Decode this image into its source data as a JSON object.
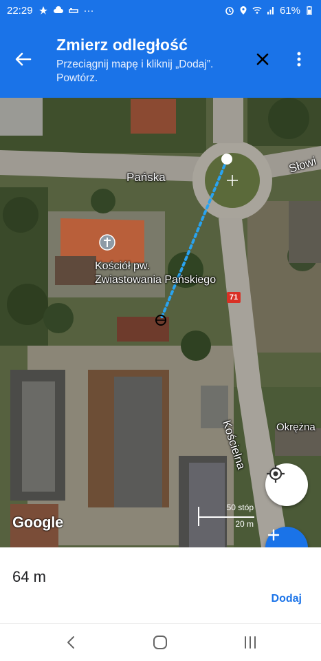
{
  "status_bar": {
    "time": "22:29",
    "more_indicator": "···",
    "battery": "61%"
  },
  "app_bar": {
    "title": "Zmierz odległość",
    "subtitle": "Przeciągnij mapę i kliknij „Dodaj”. Powtórz.",
    "icons": [
      "arrow-back-icon",
      "close-icon",
      "more-vert-icon"
    ]
  },
  "map": {
    "labels": {
      "street_panska": "Pańska",
      "street_slow": "Słowi",
      "church_line1": "Kościół pw.",
      "church_line2": "Zwiastowania Pańskiego",
      "street_koscielna": "Kościelna",
      "street_okrezna": "Okrężna",
      "road_badge": "71"
    },
    "logo": "Google",
    "scale": {
      "imperial": "50 stóp",
      "metric": "20 m"
    },
    "colors": {
      "measure_line": "#29a3f0",
      "accent": "#1a73e8",
      "road_badge": "#d93025"
    }
  },
  "bottom_sheet": {
    "distance": "64 m",
    "add_label": "Dodaj"
  },
  "nav_bar": {
    "icons": [
      "nav-back-icon",
      "nav-home-icon",
      "nav-recents-icon"
    ]
  }
}
